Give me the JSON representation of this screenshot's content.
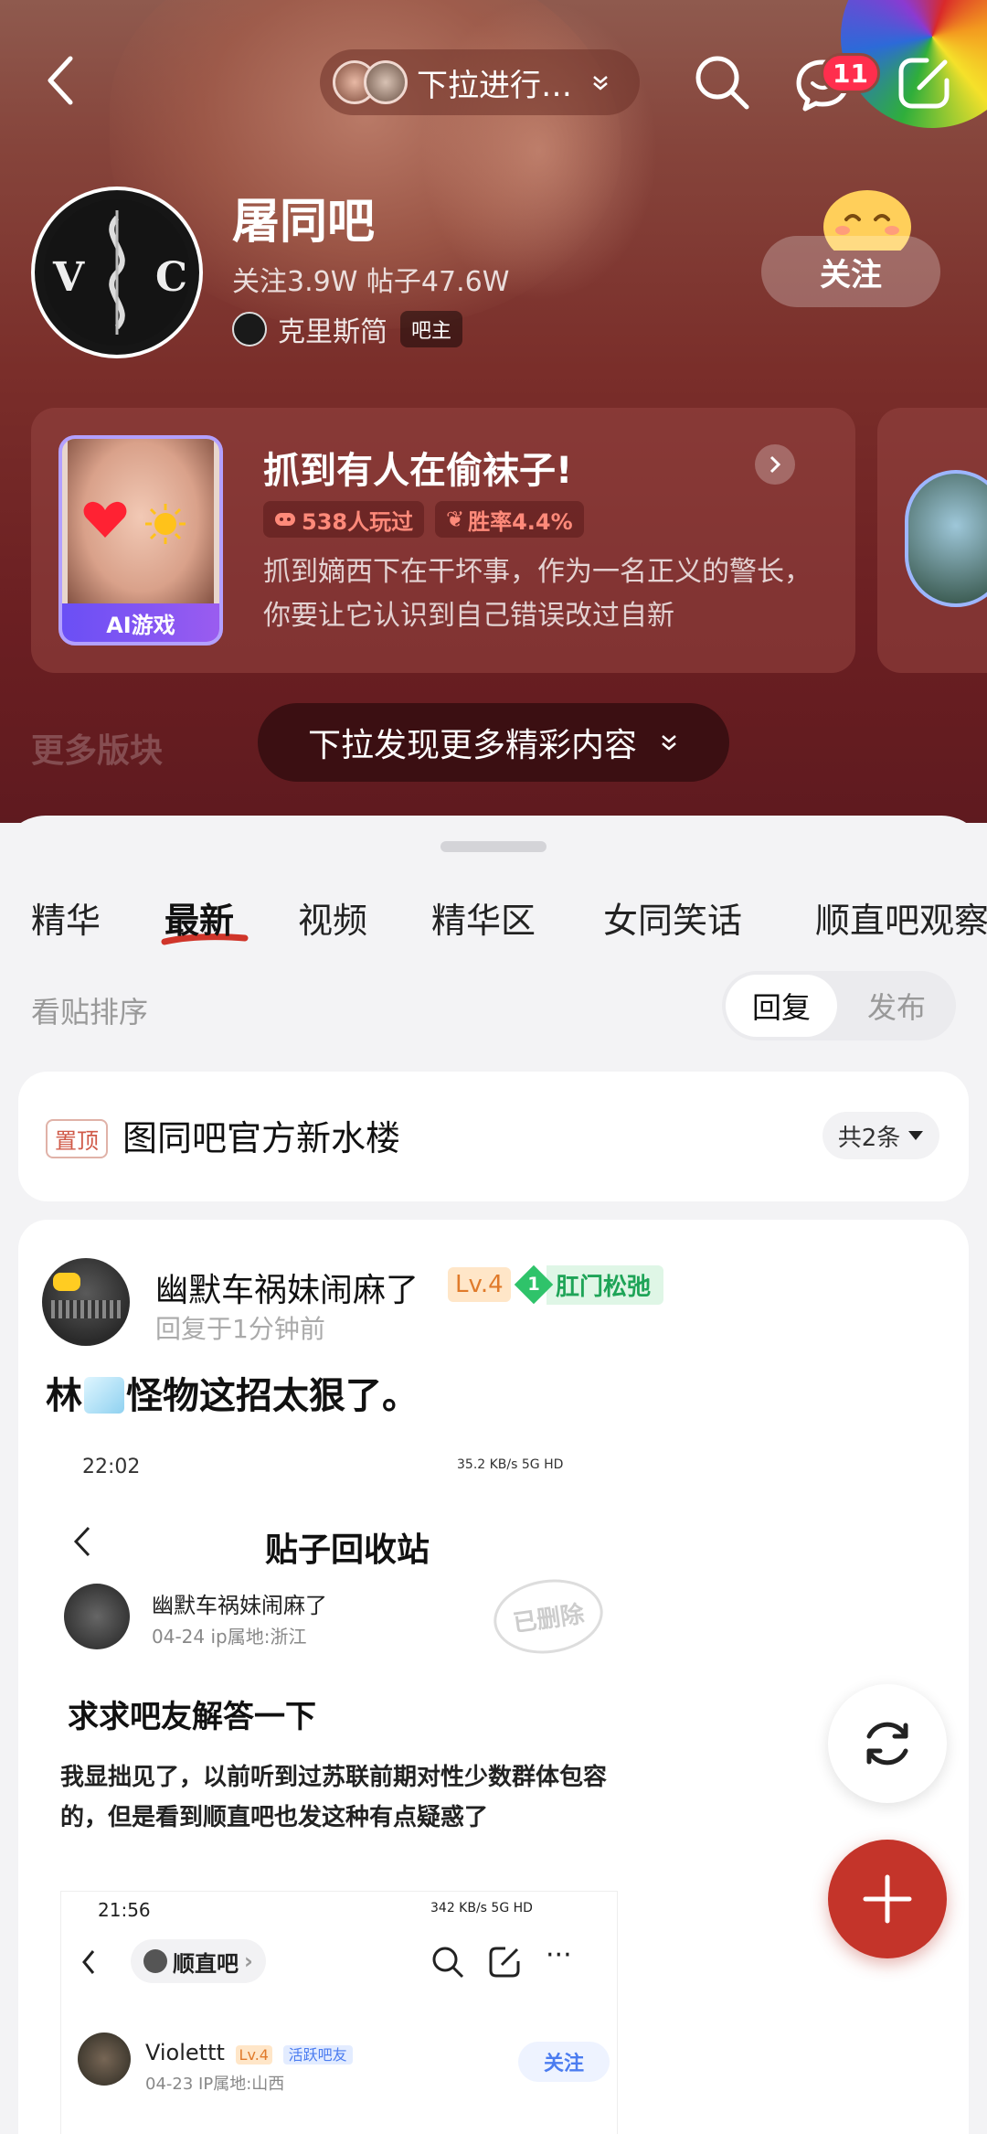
{
  "header": {
    "pull_text": "下拉进行…",
    "message_count": "11"
  },
  "forum": {
    "name": "屠同吧",
    "stats": "关注3.9W  帖子47.6W",
    "owner_name": "克里斯简",
    "owner_tag": "吧主",
    "follow_label": "关注"
  },
  "game_card": {
    "title": "抓到有人在偷袜子!",
    "players": "538人玩过",
    "win_rate": "胜率4.4%",
    "description": "抓到嫡西下在干坏事，作为一名正义的警长，你要让它认识到自己错误改过自新",
    "tag": "AI游戏"
  },
  "more_section": {
    "label": "更多版块",
    "discover_label": "下拉发现更多精彩内容"
  },
  "tabs": [
    {
      "label": "精华"
    },
    {
      "label": "最新"
    },
    {
      "label": "视频"
    },
    {
      "label": "精华区"
    },
    {
      "label": "女同笑话"
    },
    {
      "label": "顺直吧观察"
    }
  ],
  "sort": {
    "label": "看贴排序",
    "options": [
      "回复",
      "发布"
    ],
    "selected": "回复"
  },
  "pinned": {
    "tag": "置顶",
    "title": "图同吧官方新水楼",
    "count": "共2条"
  },
  "post": {
    "username": "幽默车祸妹闹麻了",
    "level": "Lv.4",
    "title_num": "1",
    "title_badge": "肛门松弛",
    "time": "回复于1分钟前",
    "title_before": "林",
    "title_after": "怪物这招太狠了。",
    "screenshot": {
      "time": "22:02",
      "status": "35.2 KB/s  5G HD",
      "page_title": "贴子回收站",
      "user": "幽默车祸妹闹麻了",
      "meta": "04-24  ip属地:浙江",
      "stamp": "已删除",
      "heading": "求求吧友解答一下",
      "body": "我显拙见了，以前听到过苏联前期对性少数群体包容的，但是看到顺直吧也发这种有点疑惑了",
      "inner": {
        "time": "21:56",
        "status": "342 KB/s  5G HD",
        "forum": "顺直吧",
        "user": "Violettt",
        "level": "Lv.4",
        "badge": "活跃吧友",
        "meta": "04-23  IP属地:山西",
        "follow": "关注"
      }
    }
  }
}
